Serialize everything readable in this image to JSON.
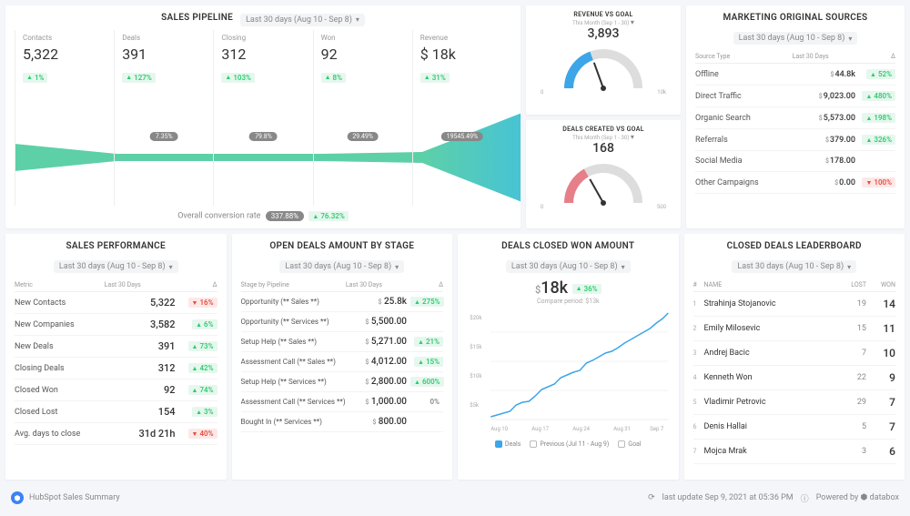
{
  "date_range": "Last 30 days (Aug 10 - Sep 8)",
  "pipeline": {
    "title": "SALES PIPELINE",
    "cols": [
      {
        "label": "Contacts",
        "value": "5,322",
        "delta": "1%",
        "dir": "up",
        "conv": null
      },
      {
        "label": "Deals",
        "value": "391",
        "delta": "127%",
        "dir": "up",
        "conv": "7.35%"
      },
      {
        "label": "Closing",
        "value": "312",
        "delta": "103%",
        "dir": "up",
        "conv": "79.8%"
      },
      {
        "label": "Won",
        "value": "92",
        "delta": "8%",
        "dir": "up",
        "conv": "29.49%"
      },
      {
        "label": "Revenue",
        "value": "$ 18k",
        "delta": "31%",
        "dir": "up",
        "conv": "19545.49%"
      }
    ],
    "overall_label": "Overall conversion rate",
    "overall_rate": "337.88%",
    "overall_delta": "76.32%"
  },
  "gauges": [
    {
      "title": "REVENUE VS GOAL",
      "sub": "This Month (Sep 1 - 30)",
      "value": "3,893",
      "min": "0",
      "max": "10k",
      "color": "#3ca6e8"
    },
    {
      "title": "DEALS CREATED VS GOAL",
      "sub": "This Month (Sep 1 - 30)",
      "value": "168",
      "min": "0",
      "max": "500",
      "color": "#e77f88"
    }
  ],
  "sources": {
    "title": "MARKETING ORIGINAL SOURCES",
    "head": [
      "Source Type",
      "Last 30 Days",
      "Δ"
    ],
    "rows": [
      {
        "name": "Offline",
        "value": "44.8k",
        "delta": "52%",
        "dir": "up"
      },
      {
        "name": "Direct Traffic",
        "value": "9,023.00",
        "delta": "480%",
        "dir": "up"
      },
      {
        "name": "Organic Search",
        "value": "5,573.00",
        "delta": "198%",
        "dir": "up"
      },
      {
        "name": "Referrals",
        "value": "379.00",
        "delta": "326%",
        "dir": "up"
      },
      {
        "name": "Social Media",
        "value": "178.00",
        "delta": "",
        "dir": ""
      },
      {
        "name": "Other Campaigns",
        "value": "0.00",
        "delta": "100%",
        "dir": "down"
      }
    ]
  },
  "performance": {
    "title": "SALES PERFORMANCE",
    "head": [
      "Metric",
      "Last 30 Days",
      "Δ"
    ],
    "rows": [
      {
        "m": "New Contacts",
        "v": "5,322",
        "d": "16%",
        "dir": "down"
      },
      {
        "m": "New Companies",
        "v": "3,582",
        "d": "6%",
        "dir": "up"
      },
      {
        "m": "New Deals",
        "v": "391",
        "d": "73%",
        "dir": "up"
      },
      {
        "m": "Closing Deals",
        "v": "312",
        "d": "42%",
        "dir": "up"
      },
      {
        "m": "Closed Won",
        "v": "92",
        "d": "74%",
        "dir": "up"
      },
      {
        "m": "Closed Lost",
        "v": "154",
        "d": "3%",
        "dir": "up"
      },
      {
        "m": "Avg. days to close",
        "v": "31d 21h",
        "d": "40%",
        "dir": "down"
      }
    ]
  },
  "stages": {
    "title": "OPEN DEALS AMOUNT BY STAGE",
    "head": [
      "Stage by Pipeline",
      "Last 30 Days",
      "Δ"
    ],
    "rows": [
      {
        "n": "Opportunity (** Sales **)",
        "v": "25.8k",
        "d": "275%",
        "dir": "up"
      },
      {
        "n": "Opportunity (** Services **)",
        "v": "5,500.00",
        "d": "",
        "dir": ""
      },
      {
        "n": "Setup Help (** Sales **)",
        "v": "5,271.00",
        "d": "21%",
        "dir": "up"
      },
      {
        "n": "Assessment Call (** Sales **)",
        "v": "4,012.00",
        "d": "15%",
        "dir": "up"
      },
      {
        "n": "Setup Help (** Services **)",
        "v": "2,800.00",
        "d": "600%",
        "dir": "up"
      },
      {
        "n": "Assessment Call (** Services **)",
        "v": "1,000.00",
        "d": "0%",
        "dir": "neutral"
      },
      {
        "n": "Bought In (** Services **)",
        "v": "800.00",
        "d": "",
        "dir": ""
      }
    ]
  },
  "closed_won": {
    "title": "DEALS CLOSED WON AMOUNT",
    "value": "18k",
    "delta": "36%",
    "compare": "Compare period: $13k",
    "legend": {
      "deals": "Deals",
      "previous": "Previous (Jul 11 - Aug 9)",
      "goal": "Goal"
    }
  },
  "leaderboard": {
    "title": "CLOSED DEALS LEADERBOARD",
    "head": [
      "#",
      "NAME",
      "LOST",
      "WON"
    ],
    "rows": [
      {
        "r": "1",
        "n": "Strahinja Stojanovic",
        "l": "19",
        "w": "14"
      },
      {
        "r": "2",
        "n": "Emily Milosevic",
        "l": "15",
        "w": "11"
      },
      {
        "r": "3",
        "n": "Andrej Bacic",
        "l": "7",
        "w": "10"
      },
      {
        "r": "4",
        "n": "Kenneth Won",
        "l": "22",
        "w": "9"
      },
      {
        "r": "5",
        "n": "Vladimir Petrovic",
        "l": "29",
        "w": "7"
      },
      {
        "r": "6",
        "n": "Denis Hallai",
        "l": "5",
        "w": "7"
      },
      {
        "r": "7",
        "n": "Mojca Mrak",
        "l": "3",
        "w": "6"
      }
    ]
  },
  "footer": {
    "title": "HubSpot Sales Summary",
    "updated": "last update Sep 9, 2021 at 05:36 PM",
    "powered": "Powered by",
    "brand": "databox"
  },
  "chart_data": {
    "closed_won_line": {
      "type": "line",
      "x": [
        "Aug 10",
        "Aug 17",
        "Aug 24",
        "Aug 31",
        "Sep 7"
      ],
      "ylim": [
        0,
        20000
      ],
      "ylabel": "$",
      "series": [
        {
          "name": "Deals",
          "color": "#3ca6e8",
          "values": [
            500,
            800,
            1200,
            1500,
            2500,
            3000,
            3200,
            4200,
            5200,
            5800,
            6200,
            7400,
            8000,
            8500,
            8800,
            10000,
            10500,
            11200,
            11800,
            12200,
            12800,
            13600,
            14200,
            14900,
            15500,
            16200,
            17200,
            18000,
            19200
          ]
        }
      ]
    },
    "gauges": [
      {
        "type": "gauge",
        "value": 3893,
        "max": 10000
      },
      {
        "type": "gauge",
        "value": 168,
        "max": 500
      }
    ]
  }
}
